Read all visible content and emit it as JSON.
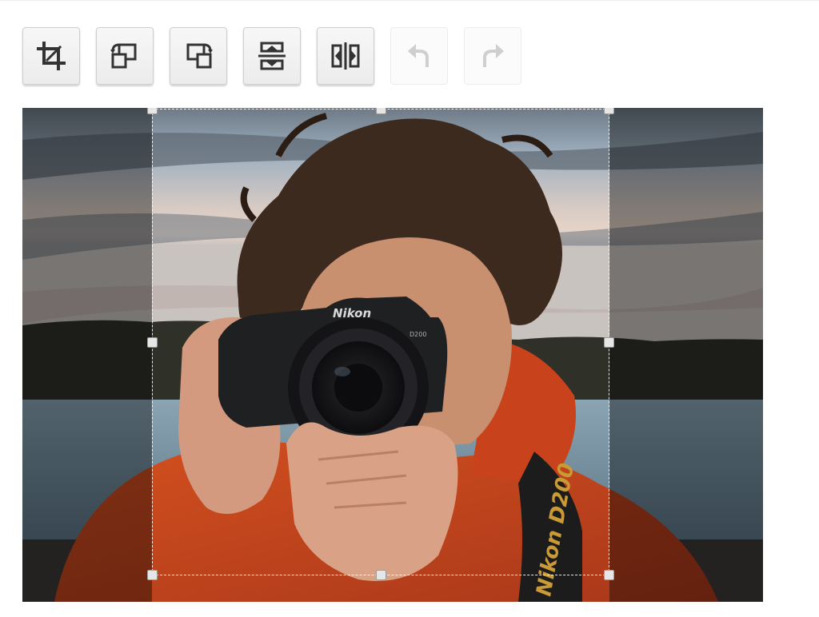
{
  "toolbar": {
    "buttons": [
      {
        "id": "crop",
        "icon": "crop-icon",
        "enabled": true
      },
      {
        "id": "rotate-left",
        "icon": "rotate-left-icon",
        "enabled": true
      },
      {
        "id": "rotate-right",
        "icon": "rotate-right-icon",
        "enabled": true
      },
      {
        "id": "flip-vertical",
        "icon": "flip-vertical-icon",
        "enabled": true
      },
      {
        "id": "flip-horizontal",
        "icon": "flip-horizontal-icon",
        "enabled": true
      },
      {
        "id": "undo",
        "icon": "undo-icon",
        "enabled": false
      },
      {
        "id": "redo",
        "icon": "redo-icon",
        "enabled": false
      }
    ]
  },
  "photo": {
    "camera_brand": "Nikon",
    "camera_model": "D200",
    "strap_text": "Nikon D200"
  },
  "colors": {
    "icon_active": "#333333",
    "icon_disabled": "#cfcfcf",
    "jacket": "#c8431c"
  }
}
